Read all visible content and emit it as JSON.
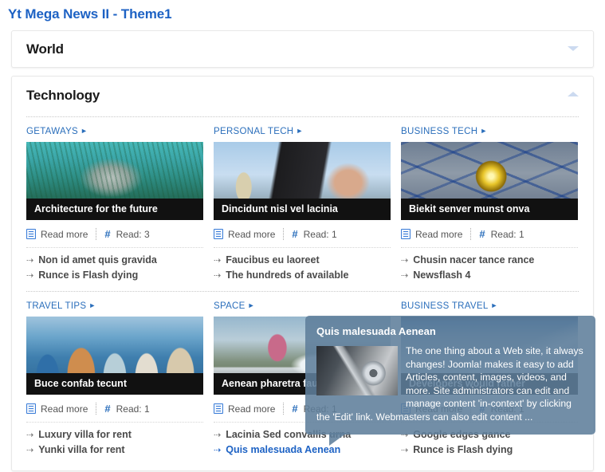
{
  "page": {
    "title": "Yt Mega News II - Theme1"
  },
  "panels": [
    {
      "title": "World",
      "state": "collapsed",
      "chevron_icon": "chevron-down-icon"
    },
    {
      "title": "Technology",
      "state": "expanded",
      "chevron_icon": "chevron-up-icon"
    }
  ],
  "meta_labels": {
    "read_more": "Read more",
    "read_count_prefix": "Read:",
    "doc_icon": "article-icon",
    "hash_icon": "hash-icon",
    "caret": "►",
    "arrow": "⇢"
  },
  "articles": [
    {
      "category": "GETAWAYS",
      "image": "img-seal",
      "image_alt": "seal-underwater-photo",
      "caption": "Architecture for the future",
      "read_more": "Read more",
      "read_count": "Read: 3",
      "sublinks": [
        {
          "label": "Non id amet quis gravida",
          "active": false
        },
        {
          "label": "Runce is Flash dying",
          "active": false
        }
      ]
    },
    {
      "category": "PERSONAL TECH",
      "image": "img-camera",
      "image_alt": "cameraman-windmill-photo",
      "caption": "Dincidunt nisl vel lacinia",
      "read_more": "Read more",
      "read_count": "Read: 1",
      "sublinks": [
        {
          "label": "Faucibus eu laoreet",
          "active": false
        },
        {
          "label": "The hundreds of available",
          "active": false
        }
      ]
    },
    {
      "category": "BUSINESS TECH",
      "image": "img-sphere",
      "image_alt": "golden-sphere-grid-render",
      "caption": "Biekit senver munst onva",
      "read_more": "Read more",
      "read_count": "Read: 1",
      "sublinks": [
        {
          "label": "Chusin nacer tance rance",
          "active": false
        },
        {
          "label": "Newsflash 4",
          "active": false
        }
      ]
    },
    {
      "category": "TRAVEL TIPS",
      "image": "img-group",
      "image_alt": "group-of-friends-harbour-photo",
      "caption": "Buce confab tecunt",
      "read_more": "Read more",
      "read_count": "Read: 1",
      "sublinks": [
        {
          "label": "Luxury villa for rent",
          "active": false
        },
        {
          "label": "Yunki villa for rent",
          "active": false
        }
      ]
    },
    {
      "category": "SPACE",
      "image": "img-splash",
      "image_alt": "water-splash-on-truck-photo",
      "caption": "Aenean pharetra faucibus nisi",
      "read_more": "Read more",
      "read_count": "Read: 1",
      "sublinks": [
        {
          "label": "Lacinia Sed convallis urna",
          "active": false
        },
        {
          "label": "Quis malesuada Aenean",
          "active": true
        }
      ]
    },
    {
      "category": "BUSINESS TRAVEL",
      "image": "img-mountain",
      "image_alt": "blue-mountain-photo",
      "caption": "Developers would rather",
      "read_more": "Read more",
      "read_count": "Read: 1",
      "sublinks": [
        {
          "label": "Google edges gance",
          "active": false
        },
        {
          "label": "Runce is Flash dying",
          "active": false
        }
      ]
    }
  ],
  "tooltip": {
    "title": "Quis malesuada Aenean",
    "thumb_alt": "hard-disk-drive-photo",
    "text": "The one thing about a Web site, it always changes! Joomla! makes it easy to add Articles, content, images, videos, and more. Site administrators can edit and manage content 'in-context' by clicking the 'Edit' link. Webmasters can also edit content ...",
    "background_color": "#5e7e9b"
  }
}
